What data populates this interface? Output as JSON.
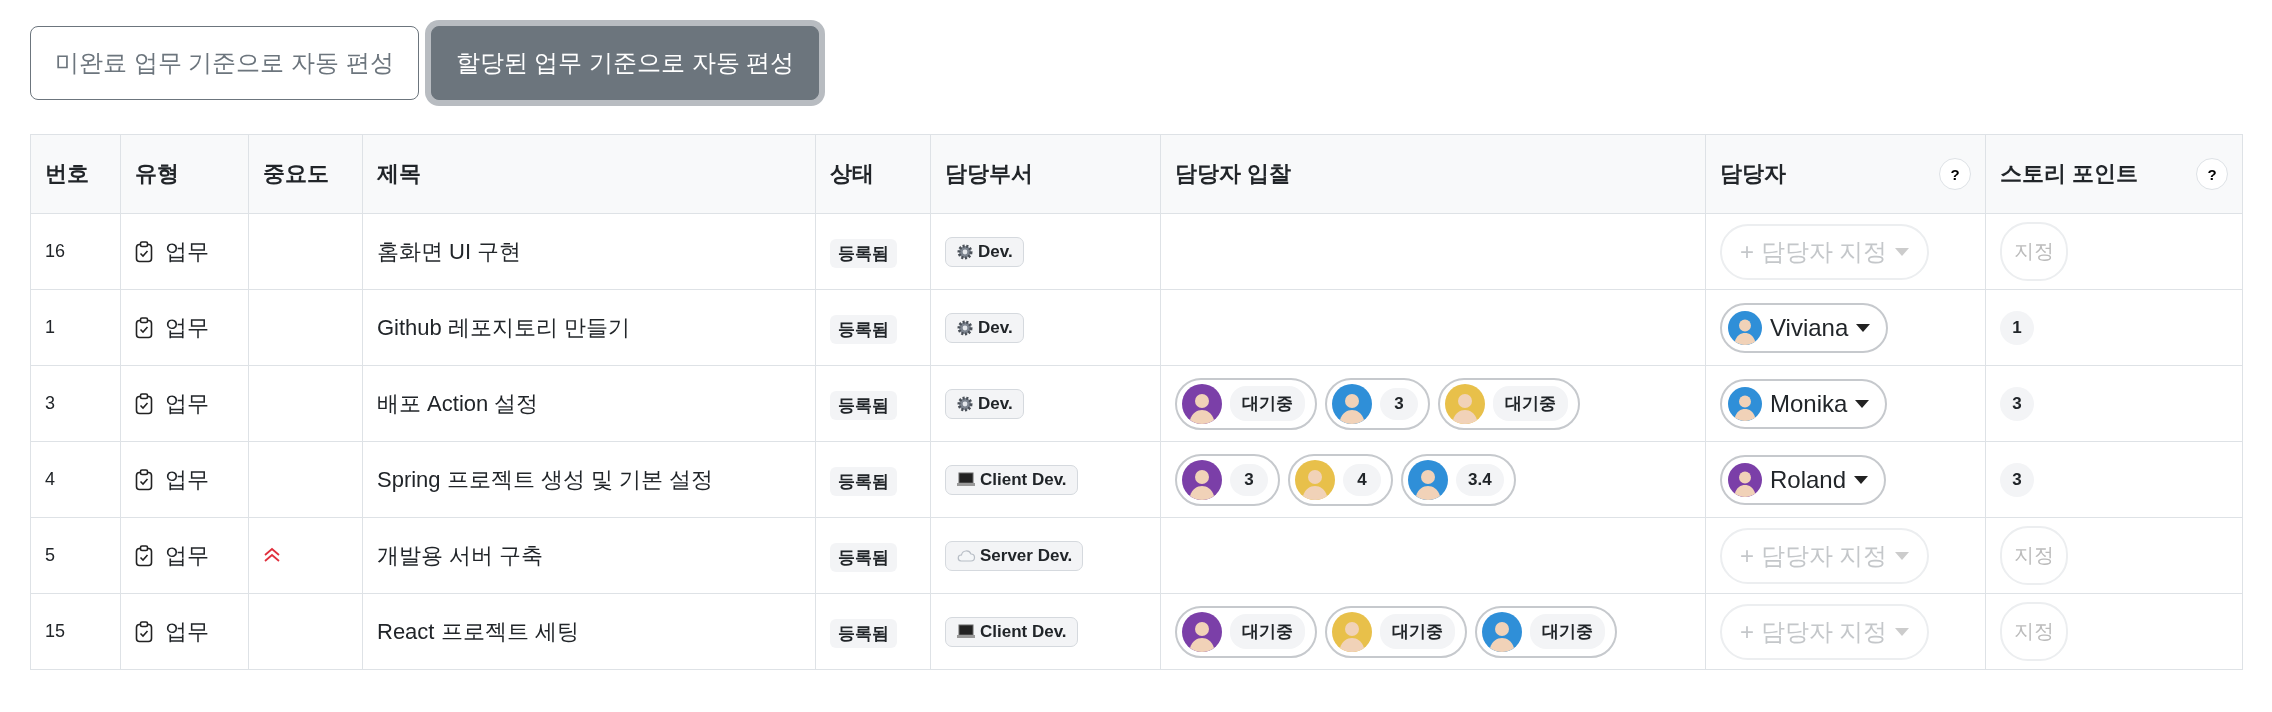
{
  "toolbar": [
    {
      "label": "미완료 업무 기준으로 자동 편성",
      "selected": false
    },
    {
      "label": "할당된 업무 기준으로 자동 편성",
      "selected": true
    }
  ],
  "table": {
    "columns": [
      {
        "label": "번호"
      },
      {
        "label": "유형"
      },
      {
        "label": "중요도"
      },
      {
        "label": "제목"
      },
      {
        "label": "상태"
      },
      {
        "label": "담당부서"
      },
      {
        "label": "담당자 입찰"
      },
      {
        "label": "담당자",
        "help": "?"
      },
      {
        "label": "스토리 포인트",
        "help": "?"
      }
    ],
    "rows": [
      {
        "number": "16",
        "type": "업무",
        "high_priority": false,
        "title": "홈화면 UI 구현",
        "status": "등록됨",
        "department": {
          "kind": "gear",
          "label": "Dev."
        },
        "bids": [],
        "assignee": {
          "kind": "empty",
          "label": "+ 담당자 지정"
        },
        "points": {
          "kind": "empty",
          "label": "지정"
        }
      },
      {
        "number": "1",
        "type": "업무",
        "high_priority": false,
        "title": "Github 레포지토리 만들기",
        "status": "등록됨",
        "department": {
          "kind": "gear",
          "label": "Dev."
        },
        "bids": [],
        "assignee": {
          "kind": "person",
          "label": "Viviana",
          "color": "#2f8fd8"
        },
        "points": {
          "kind": "value",
          "label": "1"
        }
      },
      {
        "number": "3",
        "type": "업무",
        "high_priority": false,
        "title": "배포 Action 설정",
        "status": "등록됨",
        "department": {
          "kind": "gear",
          "label": "Dev."
        },
        "bids": [
          {
            "color": "#7b3fa8",
            "label": "대기중"
          },
          {
            "color": "#2f8fd8",
            "label": "3"
          },
          {
            "color": "#e8c04a",
            "label": "대기중"
          }
        ],
        "assignee": {
          "kind": "person",
          "label": "Monika",
          "color": "#2f8fd8"
        },
        "points": {
          "kind": "value",
          "label": "3"
        }
      },
      {
        "number": "4",
        "type": "업무",
        "high_priority": false,
        "title": "Spring 프로젝트 생성 및 기본 설정",
        "status": "등록됨",
        "department": {
          "kind": "laptop",
          "label": "Client Dev."
        },
        "bids": [
          {
            "color": "#7b3fa8",
            "label": "3"
          },
          {
            "color": "#e8c04a",
            "label": "4"
          },
          {
            "color": "#2f8fd8",
            "label": "3.4"
          }
        ],
        "assignee": {
          "kind": "person",
          "label": "Roland",
          "color": "#7b3fa8"
        },
        "points": {
          "kind": "value",
          "label": "3"
        }
      },
      {
        "number": "5",
        "type": "업무",
        "high_priority": true,
        "title": "개발용 서버 구축",
        "status": "등록됨",
        "department": {
          "kind": "cloud",
          "label": "Server Dev."
        },
        "bids": [],
        "assignee": {
          "kind": "empty",
          "label": "+ 담당자 지정"
        },
        "points": {
          "kind": "empty",
          "label": "지정"
        }
      },
      {
        "number": "15",
        "type": "업무",
        "high_priority": false,
        "title": "React 프로젝트 세팅",
        "status": "등록됨",
        "department": {
          "kind": "laptop",
          "label": "Client Dev."
        },
        "bids": [
          {
            "color": "#7b3fa8",
            "label": "대기중"
          },
          {
            "color": "#e8c04a",
            "label": "대기중"
          },
          {
            "color": "#2f8fd8",
            "label": "대기중"
          }
        ],
        "assignee": {
          "kind": "empty",
          "label": "+ 담당자 지정"
        },
        "points": {
          "kind": "empty",
          "label": "지정"
        }
      }
    ]
  }
}
